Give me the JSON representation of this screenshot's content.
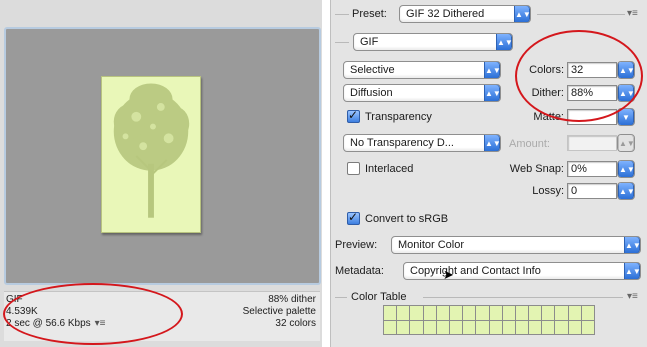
{
  "preview": {
    "info_left": [
      "GIF",
      "4.539K",
      "2 sec @ 56.6 Kbps"
    ],
    "info_menu_icon": "panel-menu-icon",
    "info_right": [
      "88% dither",
      "Selective palette",
      "32 colors"
    ]
  },
  "settings": {
    "preset_label": "Preset:",
    "preset_value": "GIF 32 Dithered",
    "format_value": "GIF",
    "reduction_value": "Selective",
    "dither_algo_value": "Diffusion",
    "transparency_label": "Transparency",
    "transparency_checked": true,
    "transparency_dither_value": "No Transparency D...",
    "interlaced_label": "Interlaced",
    "interlaced_checked": false,
    "colors_label": "Colors:",
    "colors_value": "32",
    "dither_label": "Dither:",
    "dither_value": "88%",
    "matte_label": "Matte:",
    "matte_value": "",
    "amount_label": "Amount:",
    "amount_value": "",
    "web_snap_label": "Web Snap:",
    "web_snap_value": "0%",
    "lossy_label": "Lossy:",
    "lossy_value": "0",
    "convert_srgb_label": "Convert to sRGB",
    "convert_srgb_checked": true,
    "preview_label": "Preview:",
    "preview_value": "Monitor Color",
    "metadata_label": "Metadata:",
    "metadata_value": "Copyright and Contact Info",
    "color_table_label": "Color Table"
  },
  "colors": {
    "annotation": "#d4171c",
    "swatch": "#e3f4b2",
    "artwork_bg": "#e9f7b8",
    "tree": "#b7c77e"
  }
}
